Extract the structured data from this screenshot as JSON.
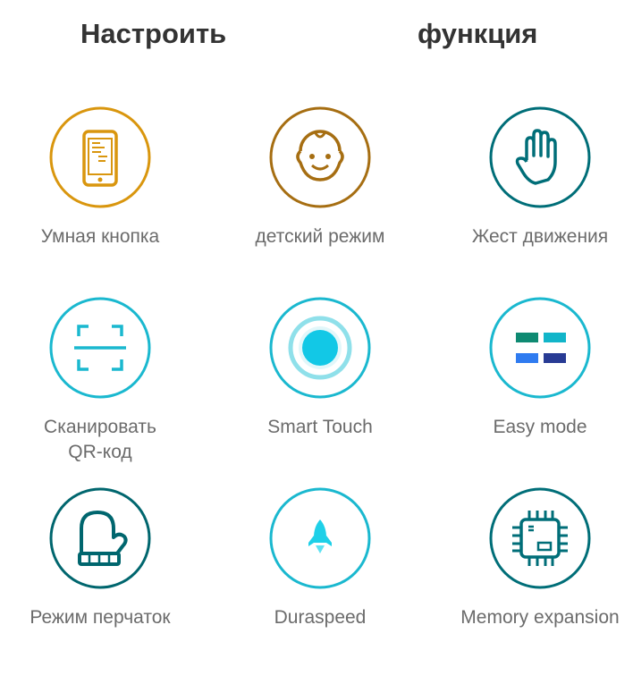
{
  "header": {
    "left_title": "Настроить",
    "right_title": "функция"
  },
  "tiles": [
    {
      "label": "Умная кнопка",
      "icon": "smartphone-icon",
      "color": "#D9960E"
    },
    {
      "label": "детский режим",
      "icon": "baby-face-icon",
      "color": "#A66E12"
    },
    {
      "label": "Жест движения",
      "icon": "hand-gesture-icon",
      "color": "#006E78"
    },
    {
      "label": "Сканировать\nQR-код",
      "icon": "qr-scan-icon",
      "color": "#1AB8CF"
    },
    {
      "label": "Smart Touch",
      "icon": "smart-touch-icon",
      "color": "#1AB8CF"
    },
    {
      "label": "Easy mode",
      "icon": "easy-mode-icon",
      "color": "#1AB8CF"
    },
    {
      "label": "Режим перчаток",
      "icon": "glove-icon",
      "color": "#00666E"
    },
    {
      "label": "Duraspeed",
      "icon": "rocket-icon",
      "color": "#1AB8CF"
    },
    {
      "label": "Memory expansion",
      "icon": "chip-icon",
      "color": "#006E78"
    }
  ]
}
